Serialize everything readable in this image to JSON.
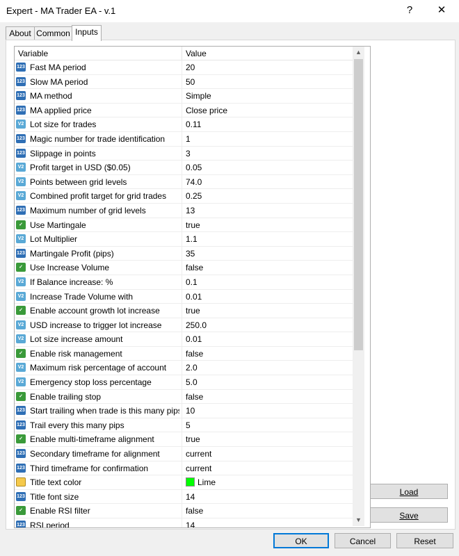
{
  "window": {
    "title": "Expert - MA Trader EA - v.1",
    "help_glyph": "?",
    "close_glyph": "✕"
  },
  "tabs": [
    {
      "label": "About"
    },
    {
      "label": "Common"
    },
    {
      "label": "Inputs",
      "active": true
    }
  ],
  "grid": {
    "col_variable": "Variable",
    "col_value": "Value",
    "rows": [
      {
        "type": "int",
        "icon": "123",
        "name": "Fast MA period",
        "value": "20"
      },
      {
        "type": "int",
        "icon": "123",
        "name": "Slow MA period",
        "value": "50"
      },
      {
        "type": "enum",
        "icon": "123",
        "name": "MA method",
        "value": "Simple"
      },
      {
        "type": "enum",
        "icon": "123",
        "name": "MA applied price",
        "value": "Close price"
      },
      {
        "type": "dbl",
        "icon": "V2",
        "name": "Lot size for trades",
        "value": "0.11"
      },
      {
        "type": "int",
        "icon": "123",
        "name": "Magic number for trade identification",
        "value": "1"
      },
      {
        "type": "int",
        "icon": "123",
        "name": "Slippage in points",
        "value": "3"
      },
      {
        "type": "dbl",
        "icon": "V2",
        "name": "Profit target in USD ($0.05)",
        "value": "0.05"
      },
      {
        "type": "dbl",
        "icon": "V2",
        "name": "Points between grid levels",
        "value": "74.0"
      },
      {
        "type": "dbl",
        "icon": "V2",
        "name": "Combined profit target for grid trades",
        "value": "0.25"
      },
      {
        "type": "int",
        "icon": "123",
        "name": "Maximum number of grid levels",
        "value": "13"
      },
      {
        "type": "bool",
        "icon": "✓",
        "name": "Use Martingale",
        "value": "true"
      },
      {
        "type": "dbl",
        "icon": "V2",
        "name": "Lot Multiplier",
        "value": "1.1"
      },
      {
        "type": "int",
        "icon": "123",
        "name": "Martingale Profit (pips)",
        "value": "35"
      },
      {
        "type": "bool",
        "icon": "✓",
        "name": "Use Increase Volume",
        "value": "false"
      },
      {
        "type": "dbl",
        "icon": "V2",
        "name": "If Balance increase: %",
        "value": "0.1"
      },
      {
        "type": "dbl",
        "icon": "V2",
        "name": "Increase Trade Volume with",
        "value": "0.01"
      },
      {
        "type": "bool",
        "icon": "✓",
        "name": "Enable account growth lot increase",
        "value": "true"
      },
      {
        "type": "dbl",
        "icon": "V2",
        "name": "USD increase to trigger lot increase",
        "value": "250.0"
      },
      {
        "type": "dbl",
        "icon": "V2",
        "name": "Lot size increase amount",
        "value": "0.01"
      },
      {
        "type": "bool",
        "icon": "✓",
        "name": "Enable risk management",
        "value": "false"
      },
      {
        "type": "dbl",
        "icon": "V2",
        "name": "Maximum risk percentage of account",
        "value": "2.0"
      },
      {
        "type": "dbl",
        "icon": "V2",
        "name": "Emergency stop loss percentage",
        "value": "5.0"
      },
      {
        "type": "bool",
        "icon": "✓",
        "name": "Enable trailing stop",
        "value": "false"
      },
      {
        "type": "int",
        "icon": "123",
        "name": "Start trailing when trade is this many pips in ...",
        "value": "10"
      },
      {
        "type": "int",
        "icon": "123",
        "name": "Trail every this many pips",
        "value": "5"
      },
      {
        "type": "bool",
        "icon": "✓",
        "name": "Enable multi-timeframe alignment",
        "value": "true"
      },
      {
        "type": "enum",
        "icon": "123",
        "name": "Secondary timeframe for alignment",
        "value": "current"
      },
      {
        "type": "enum",
        "icon": "123",
        "name": "Third timeframe for confirmation",
        "value": "current"
      },
      {
        "type": "color",
        "icon": "",
        "name": "Title text color",
        "value": "Lime",
        "swatch": "#00ff00"
      },
      {
        "type": "int",
        "icon": "123",
        "name": "Title font size",
        "value": "14"
      },
      {
        "type": "bool",
        "icon": "✓",
        "name": "Enable RSI filter",
        "value": "false"
      },
      {
        "type": "int",
        "icon": "123",
        "name": "RSI period",
        "value": "14"
      }
    ]
  },
  "side_buttons": {
    "load": "Load",
    "save": "Save"
  },
  "footer_buttons": {
    "ok": "OK",
    "cancel": "Cancel",
    "reset": "Reset"
  }
}
